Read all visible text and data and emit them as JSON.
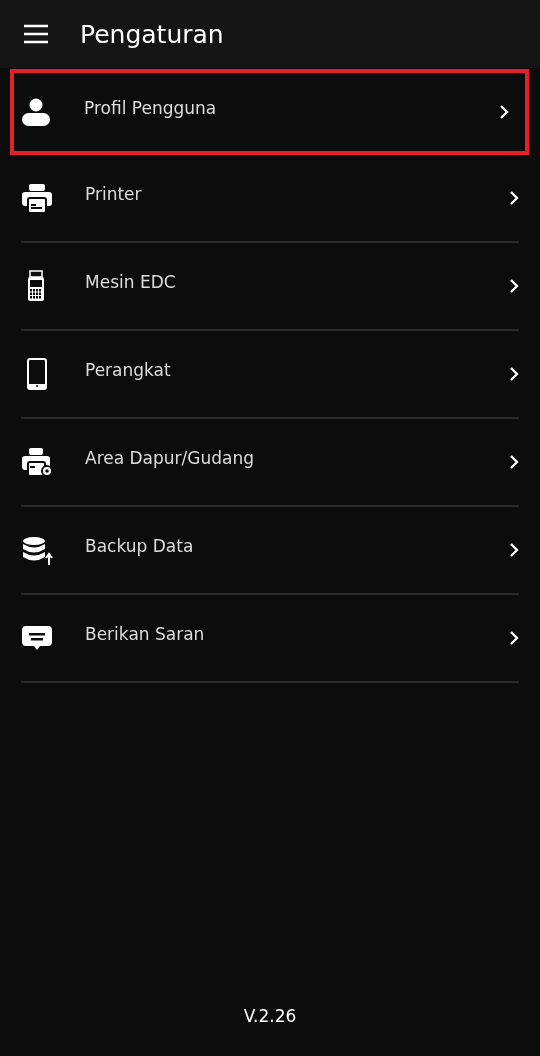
{
  "app_bar": {
    "title": "Pengaturan"
  },
  "menu": [
    {
      "kind": "user",
      "label": "Profil Pengguna",
      "highlighted": true
    },
    {
      "kind": "printer",
      "label": "Printer",
      "highlighted": false
    },
    {
      "kind": "edc",
      "label": "Mesin EDC",
      "highlighted": false
    },
    {
      "kind": "phone",
      "label": "Perangkat",
      "highlighted": false
    },
    {
      "kind": "kitchen",
      "label": "Area Dapur/Gudang",
      "highlighted": false
    },
    {
      "kind": "backup",
      "label": "Backup Data",
      "highlighted": false
    },
    {
      "kind": "feedback",
      "label": "Berikan Saran",
      "highlighted": false
    }
  ],
  "version": "V.2.26"
}
